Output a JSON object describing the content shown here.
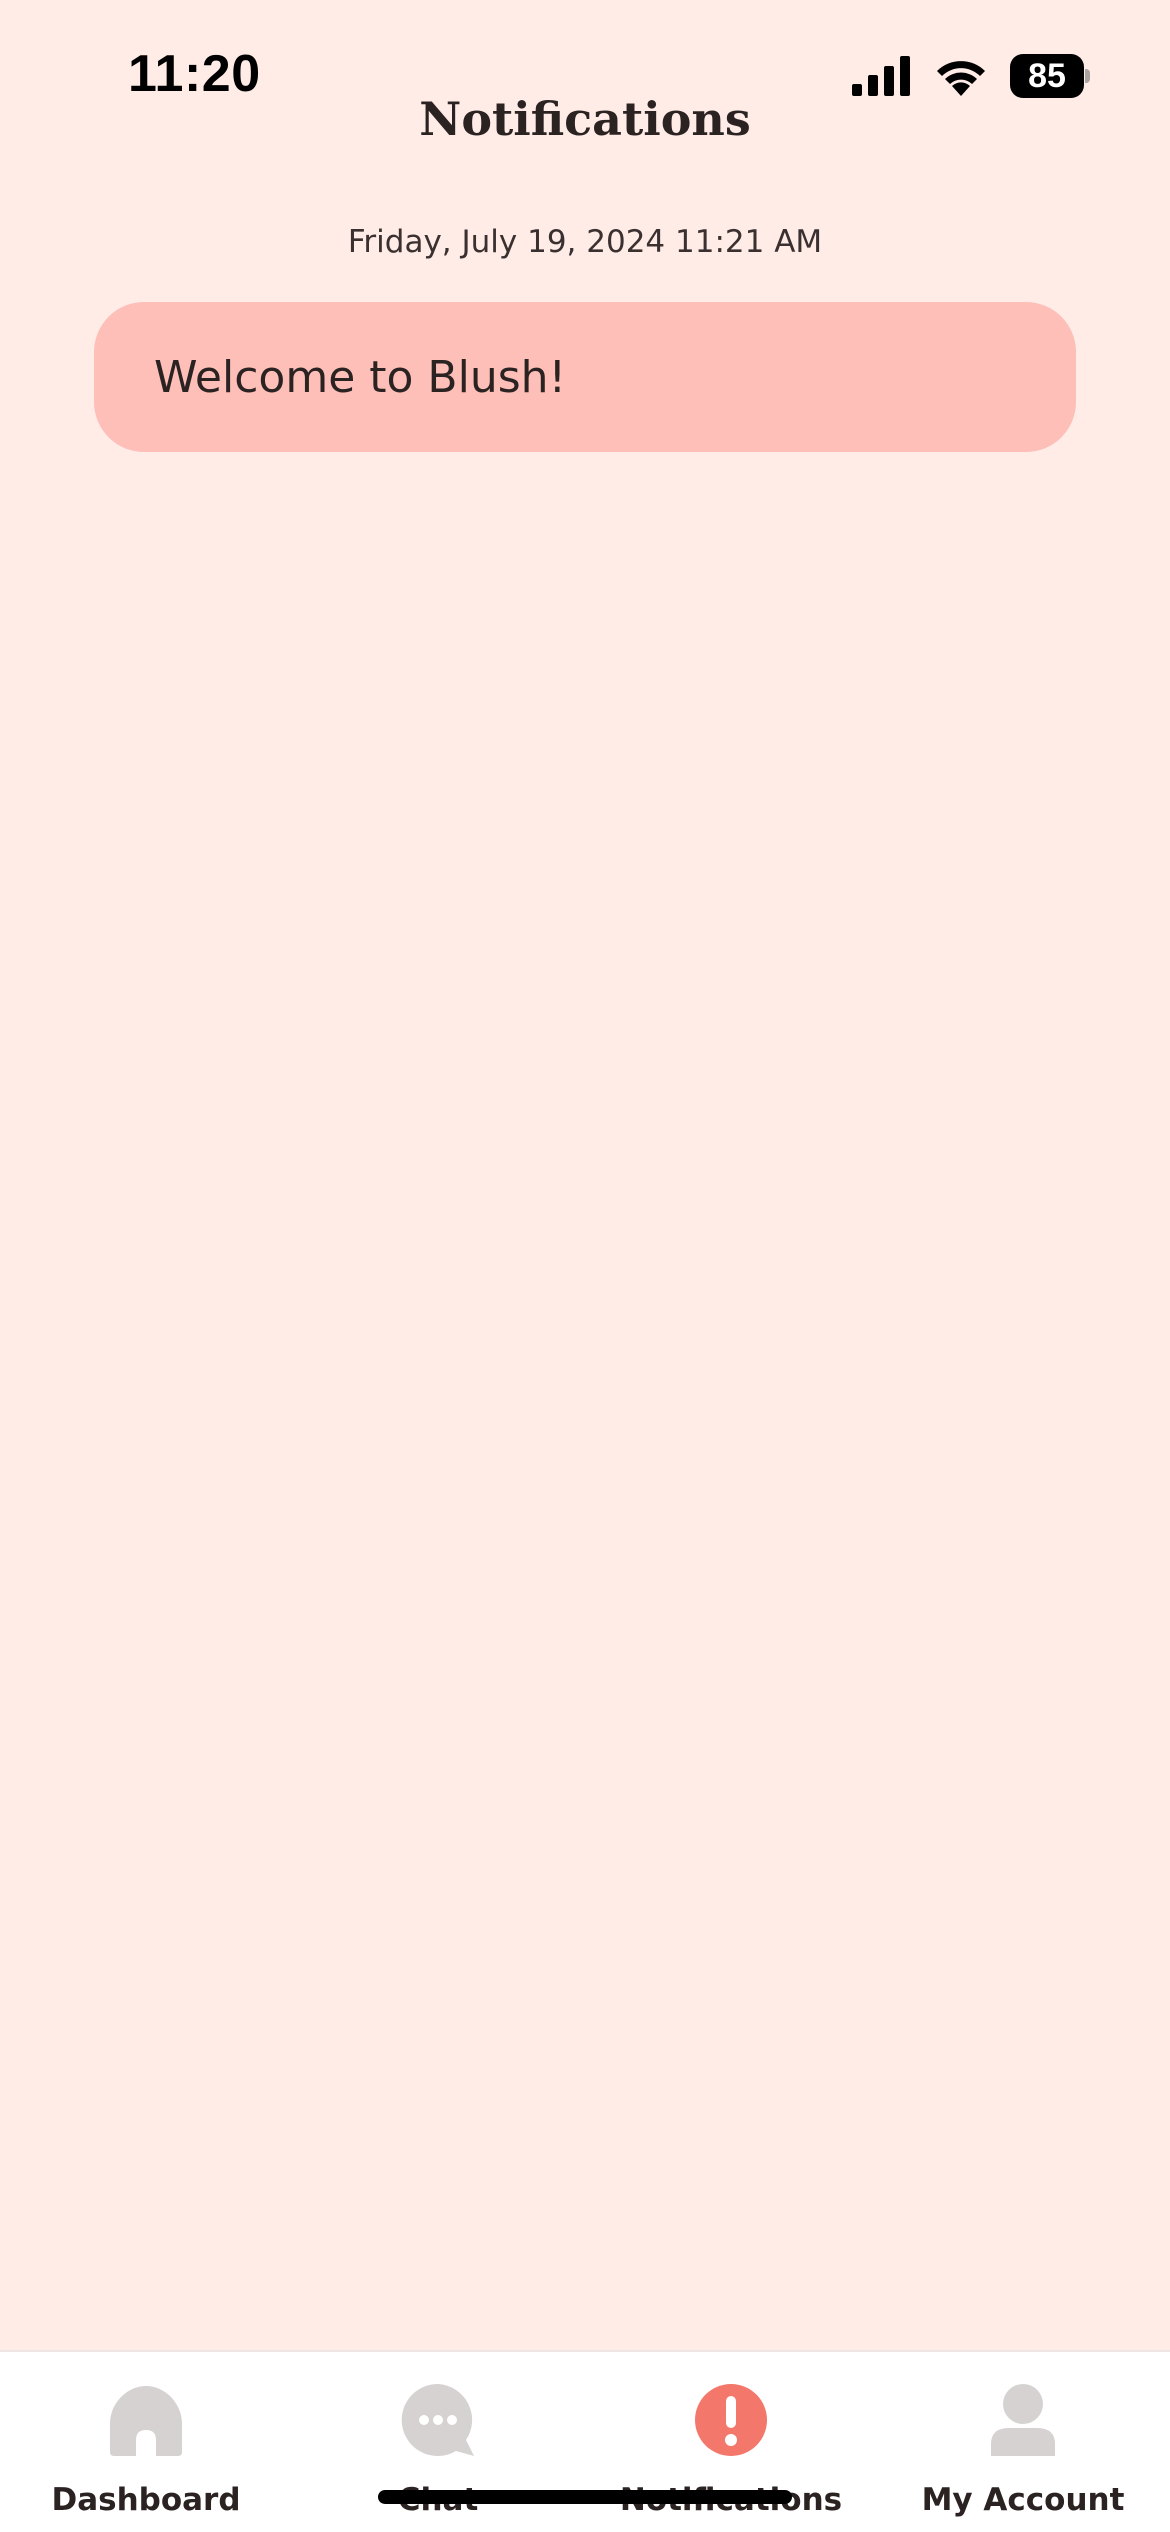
{
  "status_bar": {
    "time": "11:20",
    "battery_level": "85"
  },
  "header": {
    "title": "Notifications"
  },
  "notifications": [
    {
      "date": "Friday, July 19, 2024 11:21 AM",
      "message": "Welcome to Blush!"
    }
  ],
  "tab_bar": {
    "tabs": [
      {
        "label": "Dashboard",
        "icon": "home-icon",
        "active": false
      },
      {
        "label": "Chat",
        "icon": "chat-icon",
        "active": false
      },
      {
        "label": "Notifications",
        "icon": "alert-icon",
        "active": true
      },
      {
        "label": "My Account",
        "icon": "user-icon",
        "active": false
      }
    ]
  },
  "colors": {
    "background": "#FFECE7",
    "card": "#FDBFB8",
    "accent": "#F4776B",
    "inactive_icon": "#D6D2D1"
  }
}
